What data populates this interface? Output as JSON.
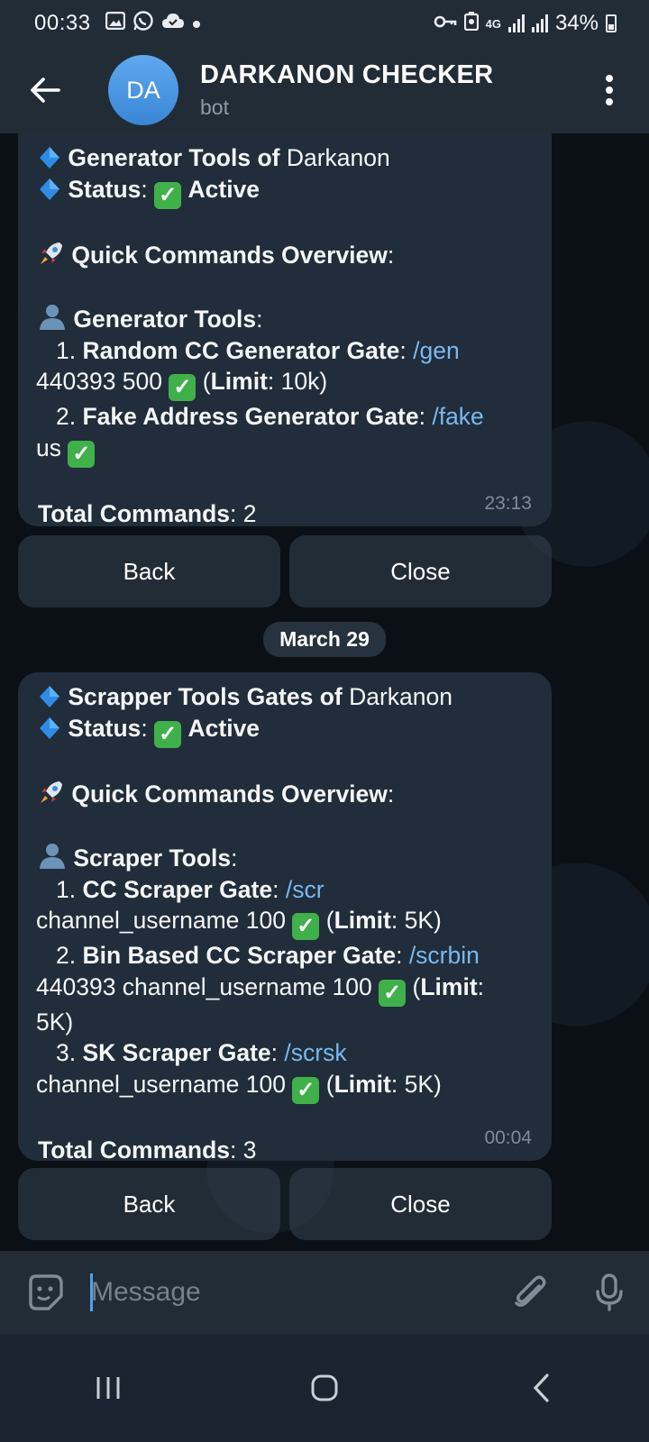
{
  "status_bar": {
    "time": "00:33",
    "battery": "34%",
    "network": "4G"
  },
  "header": {
    "avatar_initials": "DA",
    "title": "DARKANON CHECKER",
    "subtitle": "bot"
  },
  "messages": [
    {
      "time": "23:13",
      "lines": {
        "l1_bold": "Generator Tools of",
        "l1_rest": " Darkanon",
        "l2_bold": "Status",
        "l2_colon": ":",
        "l2_active": "Active",
        "overview_bold": "Quick Commands Overview",
        "colon": ":",
        "section_bold": "Generator Tools",
        "item1_num": "1.",
        "item1_name": "Random CC Generator Gate",
        "item1_cmd": "/gen",
        "item1_args": "440393 500",
        "item1_limit_label": "Limit",
        "item1_limit_value": ": 10k)",
        "item2_num": "2.",
        "item2_name": "Fake Address Generator Gate",
        "item2_cmd": "/fake",
        "item2_args": "us",
        "total_bold": "Total Commands",
        "total_value": ": 2"
      }
    },
    {
      "time": "00:04",
      "lines": {
        "l1_bold": "Scrapper Tools Gates of",
        "l1_rest": " Darkanon",
        "l2_bold": "Status",
        "l2_colon": ":",
        "l2_active": "Active",
        "overview_bold": "Quick Commands Overview",
        "colon": ":",
        "section_bold": "Scraper Tools",
        "item1_num": "1.",
        "item1_name": "CC Scraper Gate",
        "item1_cmd": "/scr",
        "item1_args": "channel_username 100",
        "item2_num": "2.",
        "item2_name": "Bin Based CC Scraper Gate",
        "item2_cmd": "/scrbin",
        "item2_args": "440393 channel_username 100",
        "item2_limit_tail": "5K)",
        "item3_num": "3.",
        "item3_name": "SK Scraper Gate",
        "item3_cmd": "/scrsk",
        "item3_args": "channel_username 100",
        "limit_label": "Limit",
        "limit_value": ": 5K)",
        "total_bold": "Total Commands",
        "total_value": ": 3"
      }
    }
  ],
  "keyboard": {
    "back_label": "Back",
    "close_label": "Close"
  },
  "date_separator": "March 29",
  "composer": {
    "placeholder": "Message"
  },
  "colors": {
    "accent": "#4aa3f0",
    "link": "#79b8f0",
    "bubble": "#212d3a",
    "check_green": "#3fb04a"
  }
}
